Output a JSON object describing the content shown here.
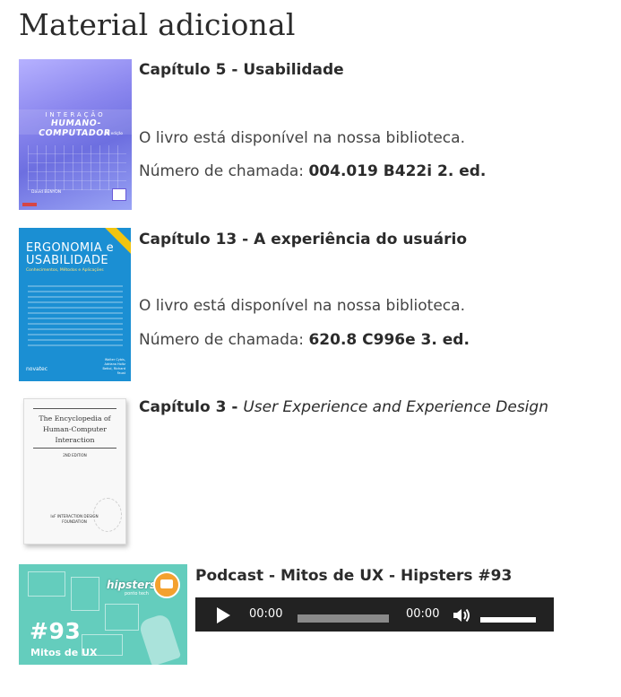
{
  "section": {
    "title": "Material adicional"
  },
  "items": [
    {
      "title": "Capítulo 5 - Usabilidade",
      "availability": "O livro está disponível na nossa biblioteca.",
      "call_label": "Número de chamada:",
      "call_number": "004.019 B422i 2. ed.",
      "cover": {
        "top_text": "INTERAÇÃO",
        "main_text": "HUMANO-COMPUTADOR",
        "edition_text": "2ª edição",
        "bottom_text": "David BENYON"
      }
    },
    {
      "title": "Capítulo 13 - A experiência do usuário",
      "availability": "O livro está disponível na nossa biblioteca.",
      "call_label": "Número de chamada:",
      "call_number": "620.8 C996e 3. ed.",
      "cover": {
        "line1": "ERGONOMIA e",
        "line2": "USABILIDADE",
        "subtitle": "Conhecimentos, Métodos e Aplicações",
        "publisher": "novatec",
        "authors": "Walter Cybis, Adriana Holtz Betiol, Richard Faust"
      }
    },
    {
      "title_prefix": "Capítulo 3 - ",
      "title_italic": "User Experience and Experience Design",
      "cover": {
        "title": "The Encyclopedia of Human-Computer Interaction",
        "edition": "2ND EDITION",
        "footer": "IxF INTERACTION DESIGN FOUNDATION"
      }
    },
    {
      "title": "Podcast - Mitos de UX - Hipsters #93",
      "cover": {
        "number": "#93",
        "label": "Mitos de UX",
        "brand": "hipsters",
        "brand_sub": "ponto tech"
      },
      "player": {
        "current_time": "00:00",
        "duration": "00:00",
        "progress": 0,
        "volume": 1.0
      }
    }
  ],
  "colors": {
    "player_bg": "#222222",
    "player_fg": "#ffffff",
    "podcast_cover": "#64cdbd",
    "ergonomia_cover": "#1b8fd3"
  },
  "icons": {
    "play": "play-icon",
    "volume": "volume-icon"
  }
}
